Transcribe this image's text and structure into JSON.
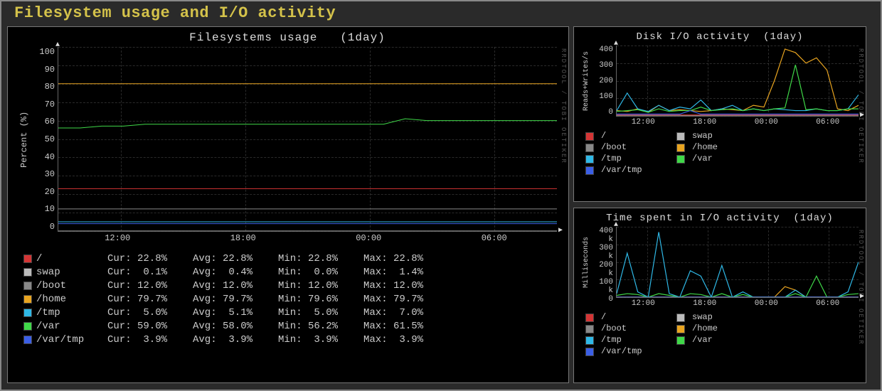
{
  "page_title": "Filesystem usage and I/O activity",
  "watermark": "RRDTOOL / TOBI OETIKER",
  "chart_data": [
    {
      "id": "fs_usage",
      "type": "line",
      "title": "Filesystems usage   (1day)",
      "ylabel": "Percent (%)",
      "ylim": [
        0,
        100
      ],
      "yticks": [
        0,
        10,
        20,
        30,
        40,
        50,
        60,
        70,
        80,
        90,
        100
      ],
      "xticks": [
        "12:00",
        "18:00",
        "00:00",
        "06:00"
      ],
      "series": [
        {
          "name": "/",
          "color": "#d43535",
          "values": [
            23,
            23,
            23,
            23,
            23,
            23,
            23,
            23,
            23,
            23,
            23,
            23,
            23,
            23,
            23,
            23,
            23,
            23,
            23,
            23,
            23,
            23,
            23,
            23
          ]
        },
        {
          "name": "swap",
          "color": "#bbbbbb",
          "values": [
            0,
            0,
            0,
            0,
            0,
            0,
            0,
            0,
            0,
            0,
            0,
            0,
            0,
            0,
            0,
            0,
            0,
            0,
            0,
            0,
            0,
            0,
            0,
            0
          ]
        },
        {
          "name": "/boot",
          "color": "#888888",
          "values": [
            12,
            12,
            12,
            12,
            12,
            12,
            12,
            12,
            12,
            12,
            12,
            12,
            12,
            12,
            12,
            12,
            12,
            12,
            12,
            12,
            12,
            12,
            12,
            12
          ]
        },
        {
          "name": "/home",
          "color": "#e8a420",
          "values": [
            80,
            80,
            80,
            80,
            80,
            80,
            80,
            80,
            80,
            80,
            80,
            80,
            80,
            80,
            80,
            80,
            80,
            80,
            80,
            80,
            80,
            80,
            80,
            80
          ]
        },
        {
          "name": "/tmp",
          "color": "#2fb8e6",
          "values": [
            5,
            5,
            5,
            5,
            5,
            5,
            5,
            5,
            5,
            5,
            5,
            5,
            5,
            5,
            5,
            5,
            5,
            5,
            5,
            5,
            5,
            5,
            5,
            5
          ]
        },
        {
          "name": "/var",
          "color": "#3fd848",
          "values": [
            56,
            56,
            57,
            57,
            58,
            58,
            58,
            58,
            58,
            58,
            58,
            58,
            58,
            58,
            58,
            58,
            61,
            60,
            60,
            60,
            60,
            60,
            60,
            60
          ]
        },
        {
          "name": "/var/tmp",
          "color": "#3b5fe6",
          "values": [
            4,
            4,
            4,
            4,
            4,
            4,
            4,
            4,
            4,
            4,
            4,
            4,
            4,
            4,
            4,
            4,
            4,
            4,
            4,
            4,
            4,
            4,
            4,
            4
          ]
        }
      ]
    },
    {
      "id": "disk_io",
      "type": "line",
      "title": "Disk I/O activity  (1day)",
      "ylabel": "Reads+Writes/s",
      "ylim": [
        0,
        400
      ],
      "yticks": [
        0,
        100,
        200,
        300,
        400
      ],
      "xticks": [
        "12:00",
        "18:00",
        "00:00",
        "06:00"
      ],
      "series": [
        {
          "name": "/",
          "color": "#d43535",
          "values": [
            5,
            5,
            5,
            5,
            5,
            5,
            5,
            5,
            5,
            5,
            5,
            5,
            5,
            5,
            5,
            5,
            5,
            5,
            5,
            5,
            5,
            5,
            5,
            5
          ]
        },
        {
          "name": "swap",
          "color": "#bbbbbb",
          "values": [
            0,
            0,
            0,
            0,
            0,
            0,
            0,
            0,
            0,
            0,
            0,
            0,
            0,
            0,
            0,
            0,
            0,
            0,
            0,
            0,
            0,
            0,
            0,
            0
          ]
        },
        {
          "name": "/boot",
          "color": "#888888",
          "values": [
            0,
            0,
            0,
            0,
            0,
            0,
            0,
            0,
            0,
            0,
            0,
            0,
            0,
            0,
            0,
            0,
            0,
            0,
            0,
            0,
            0,
            0,
            0,
            0
          ]
        },
        {
          "name": "/home",
          "color": "#e8a420",
          "values": [
            30,
            25,
            40,
            20,
            60,
            30,
            35,
            30,
            25,
            30,
            40,
            35,
            30,
            60,
            50,
            200,
            380,
            360,
            300,
            330,
            260,
            40,
            30,
            60
          ]
        },
        {
          "name": "/tmp",
          "color": "#2fb8e6",
          "values": [
            30,
            130,
            40,
            25,
            60,
            30,
            50,
            40,
            90,
            30,
            40,
            60,
            30,
            40,
            30,
            40,
            35,
            30,
            30,
            40,
            30,
            30,
            40,
            120
          ]
        },
        {
          "name": "/var",
          "color": "#3fd848",
          "values": [
            25,
            30,
            35,
            20,
            40,
            25,
            30,
            30,
            50,
            30,
            35,
            40,
            30,
            40,
            30,
            40,
            45,
            290,
            35,
            40,
            30,
            30,
            40,
            40
          ]
        },
        {
          "name": "/var/tmp",
          "color": "#3b5fe6",
          "values": [
            10,
            10,
            10,
            10,
            10,
            10,
            10,
            30,
            10,
            10,
            10,
            10,
            10,
            10,
            10,
            10,
            10,
            10,
            10,
            10,
            10,
            10,
            10,
            10
          ]
        }
      ]
    },
    {
      "id": "io_time",
      "type": "line",
      "title": "Time spent in I/O activity  (1day)",
      "ylabel": "Milliseconds",
      "ylim": [
        0,
        400000
      ],
      "yticks": [
        0,
        100000,
        200000,
        300000,
        400000
      ],
      "ytick_labels": [
        "0",
        "100 k",
        "200 k",
        "300 k",
        "400 k"
      ],
      "xticks": [
        "12:00",
        "18:00",
        "00:00",
        "06:00"
      ],
      "series": [
        {
          "name": "/",
          "color": "#d43535",
          "values": [
            0,
            0,
            0,
            0,
            0,
            0,
            0,
            0,
            0,
            0,
            0,
            0,
            0,
            0,
            0,
            0,
            0,
            0,
            0,
            0,
            0,
            0,
            0,
            0
          ]
        },
        {
          "name": "swap",
          "color": "#bbbbbb",
          "values": [
            0,
            0,
            0,
            0,
            0,
            0,
            0,
            0,
            0,
            0,
            0,
            0,
            0,
            0,
            0,
            0,
            0,
            0,
            0,
            0,
            0,
            0,
            0,
            0
          ]
        },
        {
          "name": "/boot",
          "color": "#888888",
          "values": [
            0,
            0,
            0,
            0,
            0,
            0,
            0,
            0,
            0,
            0,
            0,
            0,
            0,
            0,
            0,
            0,
            0,
            0,
            0,
            0,
            0,
            0,
            0,
            0
          ]
        },
        {
          "name": "/home",
          "color": "#e8a420",
          "values": [
            0,
            0,
            0,
            0,
            0,
            0,
            0,
            0,
            0,
            0,
            0,
            0,
            0,
            0,
            0,
            0,
            60000,
            40000,
            0,
            0,
            0,
            0,
            0,
            0
          ]
        },
        {
          "name": "/tmp",
          "color": "#2fb8e6",
          "values": [
            20000,
            250000,
            30000,
            0,
            370000,
            20000,
            0,
            150000,
            120000,
            0,
            180000,
            0,
            30000,
            0,
            0,
            0,
            0,
            40000,
            0,
            0,
            0,
            0,
            30000,
            200000
          ]
        },
        {
          "name": "/var",
          "color": "#3fd848",
          "values": [
            10000,
            20000,
            15000,
            0,
            20000,
            10000,
            0,
            20000,
            15000,
            0,
            20000,
            0,
            15000,
            0,
            0,
            0,
            0,
            20000,
            0,
            120000,
            0,
            0,
            15000,
            20000
          ]
        },
        {
          "name": "/var/tmp",
          "color": "#3b5fe6",
          "values": [
            0,
            0,
            0,
            0,
            0,
            0,
            0,
            0,
            0,
            0,
            0,
            0,
            0,
            0,
            0,
            0,
            0,
            0,
            0,
            0,
            0,
            0,
            0,
            0
          ]
        }
      ]
    }
  ],
  "stats": [
    {
      "name": "/",
      "color": "#d43535",
      "cur": "22.8%",
      "avg": "22.8%",
      "min": "22.8%",
      "max": "22.8%"
    },
    {
      "name": "swap",
      "color": "#bbbbbb",
      "cur": " 0.1%",
      "avg": " 0.4%",
      "min": " 0.0%",
      "max": " 1.4%"
    },
    {
      "name": "/boot",
      "color": "#888888",
      "cur": "12.0%",
      "avg": "12.0%",
      "min": "12.0%",
      "max": "12.0%"
    },
    {
      "name": "/home",
      "color": "#e8a420",
      "cur": "79.7%",
      "avg": "79.7%",
      "min": "79.6%",
      "max": "79.7%"
    },
    {
      "name": "/tmp",
      "color": "#2fb8e6",
      "cur": " 5.0%",
      "avg": " 5.1%",
      "min": " 5.0%",
      "max": " 7.0%"
    },
    {
      "name": "/var",
      "color": "#3fd848",
      "cur": "59.0%",
      "avg": "58.0%",
      "min": "56.2%",
      "max": "61.5%"
    },
    {
      "name": "/var/tmp",
      "color": "#3b5fe6",
      "cur": " 3.9%",
      "avg": " 3.9%",
      "min": " 3.9%",
      "max": " 3.9%"
    }
  ],
  "stat_labels": {
    "cur": "Cur:",
    "avg": "Avg:",
    "min": "Min:",
    "max": "Max:"
  },
  "mini_legend": [
    {
      "name": "/",
      "color": "#d43535"
    },
    {
      "name": "swap",
      "color": "#bbbbbb"
    },
    {
      "name": "/boot",
      "color": "#888888"
    },
    {
      "name": "/home",
      "color": "#e8a420"
    },
    {
      "name": "/tmp",
      "color": "#2fb8e6"
    },
    {
      "name": "/var",
      "color": "#3fd848"
    },
    {
      "name": "/var/tmp",
      "color": "#3b5fe6"
    }
  ]
}
